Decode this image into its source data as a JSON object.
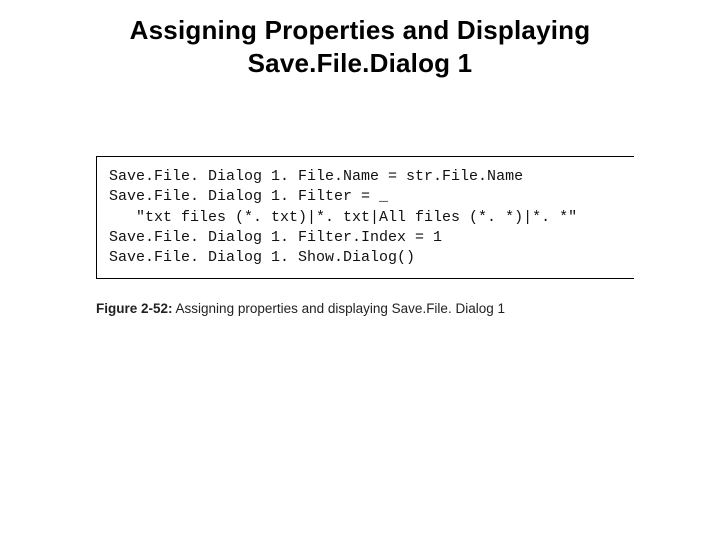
{
  "title": {
    "line1": "Assigning Properties and Displaying",
    "line2": "Save.File.Dialog 1"
  },
  "code": {
    "lines": [
      "Save.File. Dialog 1. File.Name = str.File.Name",
      "Save.File. Dialog 1. Filter = _",
      "   \"txt files (*. txt)|*. txt|All files (*. *)|*. *\"",
      "Save.File. Dialog 1. Filter.Index = 1",
      "Save.File. Dialog 1. Show.Dialog()"
    ]
  },
  "caption": {
    "label": "Figure 2-52:",
    "text": " Assigning properties and displaying Save.File. Dialog 1"
  }
}
